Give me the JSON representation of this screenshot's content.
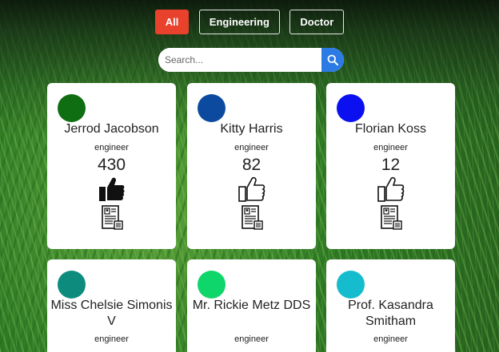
{
  "filters": [
    {
      "label": "All",
      "active": true
    },
    {
      "label": "Engineering",
      "active": false
    },
    {
      "label": "Doctor",
      "active": false
    }
  ],
  "search": {
    "placeholder": "Search..."
  },
  "cards": [
    {
      "name": "Jerrod Jacobson",
      "role": "engineer",
      "likes": "430",
      "avatar_color": "#0f6d12",
      "liked": true
    },
    {
      "name": "Kitty Harris",
      "role": "engineer",
      "likes": "82",
      "avatar_color": "#0c4aa0",
      "liked": false
    },
    {
      "name": "Florian Koss",
      "role": "engineer",
      "likes": "12",
      "avatar_color": "#0a10f0",
      "liked": false
    },
    {
      "name": "Miss Chelsie Simonis V",
      "role": "engineer",
      "avatar_color": "#0d8c7e"
    },
    {
      "name": "Mr. Rickie Metz DDS",
      "role": "engineer",
      "avatar_color": "#0fd66a"
    },
    {
      "name": "Prof. Kasandra Smitham",
      "role": "engineer",
      "avatar_color": "#14bccd"
    }
  ]
}
